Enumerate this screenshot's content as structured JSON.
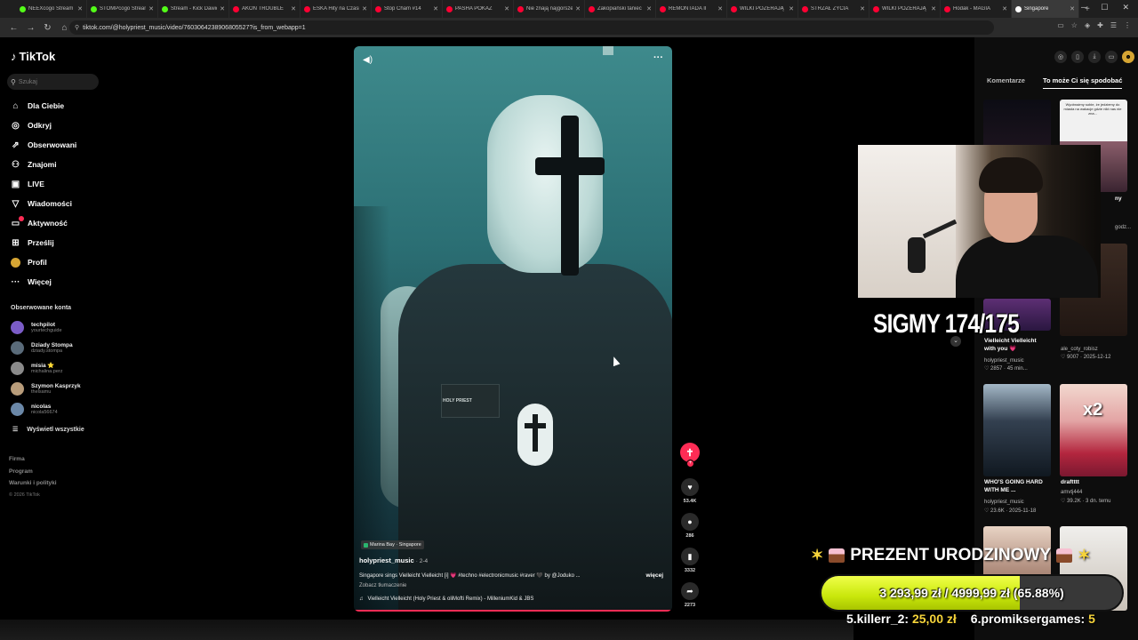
{
  "browser": {
    "tabs": [
      {
        "label": "NEEXcogo Stream",
        "color": "#53fc18"
      },
      {
        "label": "STOMPcogo Stream",
        "color": "#53fc18"
      },
      {
        "label": "Stream - Kick Dawid",
        "color": "#53fc18"
      },
      {
        "label": "AKON TROUBLE",
        "color": "#ff0033"
      },
      {
        "label": "ESKA Hity na Czasie",
        "color": "#ff0033"
      },
      {
        "label": "Stop Cham #14",
        "color": "#ff0033"
      },
      {
        "label": "PASHA POKAZ",
        "color": "#ff0033"
      },
      {
        "label": "Nie znają najgorszego",
        "color": "#ff0033"
      },
      {
        "label": "Zakopiański taniec",
        "color": "#ff0033"
      },
      {
        "label": "REMONTADA II",
        "color": "#ff0033"
      },
      {
        "label": "WILKI POŻERAJĄ",
        "color": "#ff0033"
      },
      {
        "label": "STRZAŁ ŻYCIA",
        "color": "#ff0033"
      },
      {
        "label": "WILKI POŻERAJĄ",
        "color": "#ff0033"
      },
      {
        "label": "Hodak - MAGIA",
        "color": "#ff0033"
      },
      {
        "label": "Singapore",
        "color": "#ffffff"
      }
    ],
    "url": "tiktok.com/@holypriest_music/video/7603064238906805527?is_from_webapp=1"
  },
  "sidebar": {
    "brand": "TikTok",
    "search_placeholder": "Szukaj",
    "menu": [
      {
        "label": "Dla Ciebie",
        "icon": "home-icon",
        "glyph": "⌂"
      },
      {
        "label": "Odkryj",
        "icon": "compass-icon",
        "glyph": "◎"
      },
      {
        "label": "Obserwowani",
        "icon": "following-icon",
        "glyph": "⇗"
      },
      {
        "label": "Znajomi",
        "icon": "friends-icon",
        "glyph": "⚇"
      },
      {
        "label": "LIVE",
        "icon": "live-icon",
        "glyph": "▣"
      },
      {
        "label": "Wiadomości",
        "icon": "messages-icon",
        "glyph": "▽"
      },
      {
        "label": "Aktywność",
        "icon": "activity-icon",
        "glyph": "▭"
      },
      {
        "label": "Prześlij",
        "icon": "upload-icon",
        "glyph": "⊞"
      },
      {
        "label": "Profil",
        "icon": "profile-icon",
        "glyph": ""
      },
      {
        "label": "Więcej",
        "icon": "more-icon",
        "glyph": "···"
      }
    ],
    "following_title": "Obserwowane konta",
    "following": [
      {
        "name": "techpilot",
        "handle": "yourtechguide",
        "color": "#7b5cc7"
      },
      {
        "name": "Dziady Stompa",
        "handle": "dziady.stompa",
        "color": "#5a6b7a"
      },
      {
        "name": "misia ⭐",
        "handle": "michalina.perz",
        "color": "#8a8a8a"
      },
      {
        "name": "Szymon Kasprzyk",
        "handle": "thelsamu",
        "color": "#b89c7a"
      },
      {
        "name": "nicolaѕ",
        "handle": "nicola56674",
        "color": "#6b88a8"
      }
    ],
    "show_all": "Wyświetl wszystkie",
    "footer": [
      "Firma",
      "Program",
      "Warunki i polityki"
    ],
    "copyright": "© 2026 TikTok"
  },
  "video": {
    "location": "Marina Bay · Singapore",
    "author": "holypriest_music",
    "age": "· 2-4",
    "caption": "Singapore sings Vielleicht Vielleicht [i] 💗 #techno #electronicmusic #raver 🖤 by @Joduko ...",
    "more": "więcej",
    "translate": "Zobacz tłumaczenie",
    "music": "Vielleicht Vielleicht (Holy Priest & oliMofti Remix) - MilleniumKid & JBS",
    "patch_text": "HOLY PRIEST",
    "progress": 1.0
  },
  "actions": {
    "likes": "53.4K",
    "comments": "286",
    "saves": "3332",
    "shares": "2273"
  },
  "right_panel": {
    "tabs": [
      "Komentarze",
      "To może Ci się spodobać"
    ],
    "thumb1_text": "Wyobraźmy sobie, że jedziemy do miasta na wakacje gdzie nikt nas nie zna...",
    "t_my": "ny",
    "t_godz": "godz...",
    "t_vielleicht": "Vielleicht Vielleicht with you 💗",
    "t_vielleicht_author": "holypriest_music",
    "t_vielleicht_meta": "♡ 2857 · 45 min...",
    "t_ale": "ale_coty_robisz",
    "t_ale_meta": "♡ 9007 · 2025-12-12",
    "t_who": "WHO'S GOING HARD WITH ME ...",
    "t_who_author": "holypriest_music",
    "t_who_meta": "♡ 23.6K · 2025-11-18",
    "t_x2": "x2",
    "t_draft": "draftttt",
    "t_draft_author": "amvtj444",
    "t_draft_meta": "♡ 39.2K · 3 dn. temu"
  },
  "overlays": {
    "sigmy": "SIGMY 174/175",
    "prezent": "PREZENT URODZINOWY",
    "goal_current": "3 293,99 zł",
    "goal_sep": "/",
    "goal_target": "4999,99 zł",
    "goal_pct": "(65.88%)",
    "goal_fraction": 0.6588,
    "donors": [
      {
        "label": "5.killerr_2:",
        "amount": "25,00 zł"
      },
      {
        "label": "6.promiksergames:",
        "amount": "5"
      }
    ]
  }
}
